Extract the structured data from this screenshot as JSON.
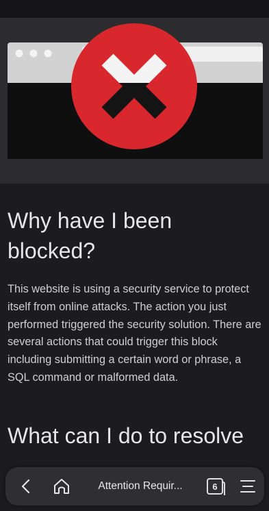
{
  "blocked_page": {
    "heading_why": "Why have I been blocked?",
    "paragraph": "This website is using a security service to protect itself from online attacks. The action you just performed triggered the security solution. There are several actions that could trigger this block including submitting a certain word or phrase, a SQL command or malformed data.",
    "heading_resolve": "What can I do to resolve"
  },
  "browser_bar": {
    "tab_title": "Attention Requir...",
    "tab_count": "6",
    "icons": {
      "back": "back-arrow-icon",
      "home": "home-icon",
      "tabs": "tabs-icon",
      "menu": "menu-icon"
    }
  },
  "colors": {
    "background": "#1c1c1e",
    "error_red": "#d9272e",
    "text": "#cfcfcf"
  }
}
